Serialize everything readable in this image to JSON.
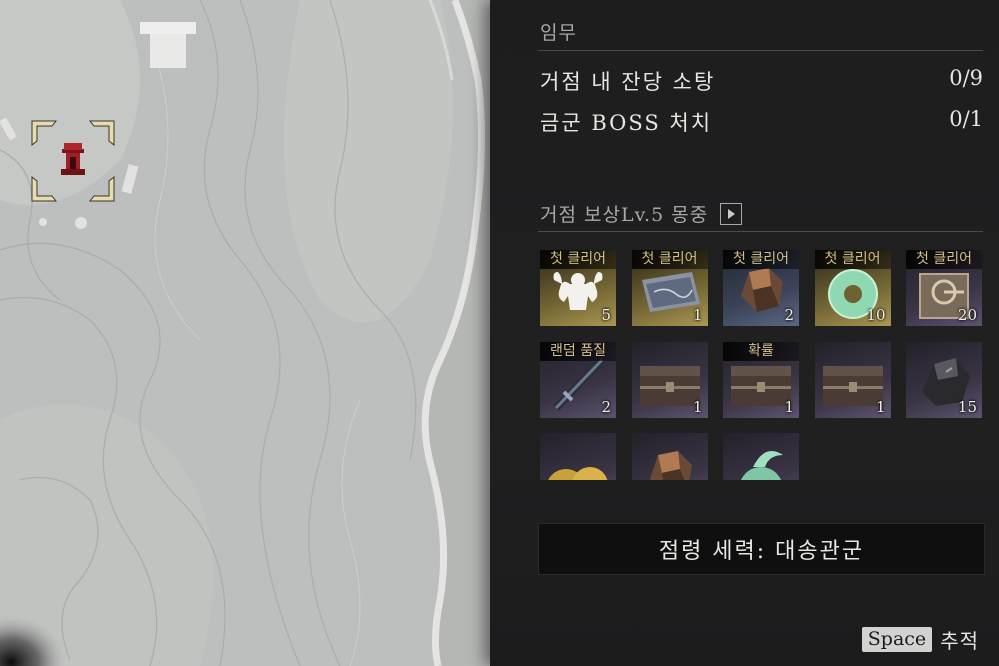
{
  "map": {
    "marker_icon": "shrine-gate-icon",
    "selection_icon": "target-bracket-icon"
  },
  "tasks": {
    "title": "임무",
    "items": [
      {
        "name": "거점 내 잔당 소탕",
        "count": "0/9"
      },
      {
        "name": "금군 BOSS 처치",
        "count": "0/1"
      }
    ]
  },
  "rewards": {
    "title": "거점 보상Lv.5 몽중",
    "items": [
      {
        "tag": "첫 클리어",
        "qty": "5",
        "icon": "muscle-icon",
        "rarity": "gold"
      },
      {
        "tag": "첫 클리어",
        "qty": "1",
        "icon": "scroll-map-icon",
        "rarity": "gold"
      },
      {
        "tag": "첫 클리어",
        "qty": "2",
        "icon": "ore-icon",
        "rarity": "steel"
      },
      {
        "tag": "첫 클리어",
        "qty": "10",
        "icon": "jade-disc-icon",
        "rarity": "gold"
      },
      {
        "tag": "첫 클리어",
        "qty": "20",
        "icon": "seal-box-icon",
        "rarity": "purple"
      },
      {
        "tag": "랜덤 품질",
        "qty": "2",
        "icon": "sword-icon",
        "rarity": "purple"
      },
      {
        "tag": "",
        "qty": "1",
        "icon": "chest-icon",
        "rarity": "purple"
      },
      {
        "tag": "확률",
        "qty": "1",
        "icon": "chest-icon",
        "rarity": "purple"
      },
      {
        "tag": "",
        "qty": "1",
        "icon": "chest-icon",
        "rarity": "purple"
      },
      {
        "tag": "",
        "qty": "15",
        "icon": "dark-ore-icon",
        "rarity": "purple"
      },
      {
        "tag": "",
        "qty": "",
        "icon": "coins-icon",
        "rarity": "purple"
      },
      {
        "tag": "",
        "qty": "",
        "icon": "ore-icon",
        "rarity": "purple"
      },
      {
        "tag": "",
        "qty": "",
        "icon": "jade-pendant-icon",
        "rarity": "purple"
      }
    ]
  },
  "occupy": {
    "label": "점령 세력: 대송관군"
  },
  "footer": {
    "key": "Space",
    "action": "추적"
  },
  "colors": {
    "panel_bg": "#1d1d1e",
    "text": "#e8e6e1",
    "muted": "#a7a7a4",
    "tag_gold": "#d4bf8a",
    "marker_red": "#9e1f24",
    "bracket_gold": "#e9dbb0"
  }
}
